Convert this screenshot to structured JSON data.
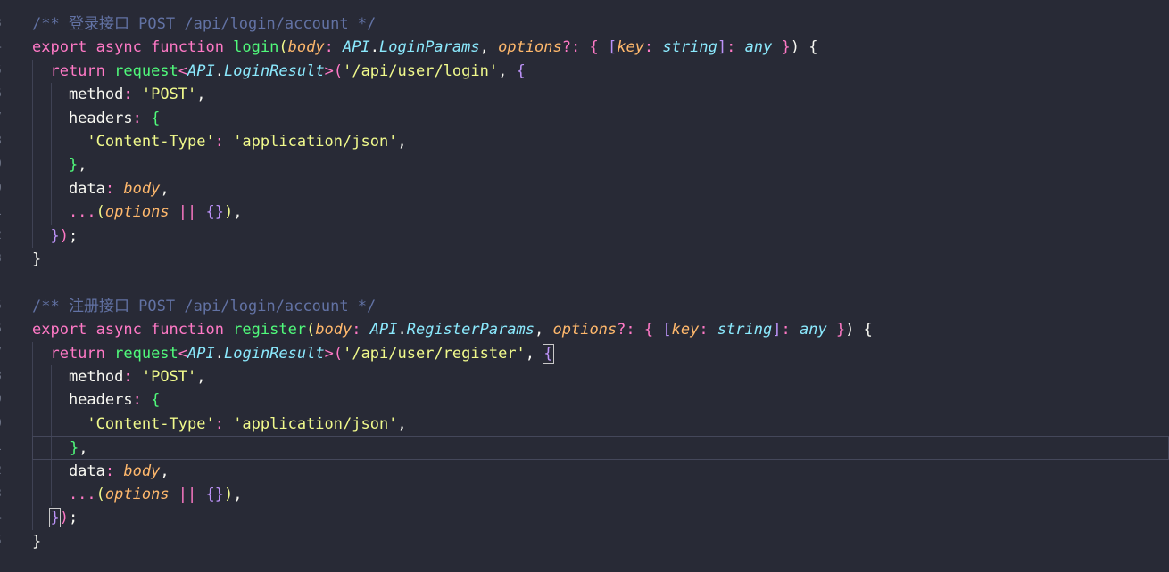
{
  "editor": {
    "gutter_numbers": [
      "3",
      "4",
      "5",
      "6",
      "7",
      "8",
      "9",
      "0",
      "1",
      "2",
      "3",
      "",
      "5",
      "6",
      "7",
      "8",
      "9",
      "0",
      "1",
      "2",
      "3",
      "4",
      "5"
    ],
    "lines": [
      [
        {
          "t": "/** 登录接口 POST /api/login/account */",
          "c": "c-comment"
        }
      ],
      [
        {
          "t": "export async function ",
          "c": "c-kw"
        },
        {
          "t": "login",
          "c": "c-fn"
        },
        {
          "t": "(",
          "c": "c-b1"
        },
        {
          "t": "body",
          "c": "c-param"
        },
        {
          "t": ": ",
          "c": "c-op"
        },
        {
          "t": "API",
          "c": "c-type"
        },
        {
          "t": ".",
          "c": "c-punc"
        },
        {
          "t": "LoginParams",
          "c": "c-type"
        },
        {
          "t": ", ",
          "c": "c-punc"
        },
        {
          "t": "options",
          "c": "c-param"
        },
        {
          "t": "?: ",
          "c": "c-op"
        },
        {
          "t": "{ ",
          "c": "c-b2"
        },
        {
          "t": "[",
          "c": "c-b3"
        },
        {
          "t": "key",
          "c": "c-param"
        },
        {
          "t": ": ",
          "c": "c-op"
        },
        {
          "t": "string",
          "c": "c-type"
        },
        {
          "t": "]",
          "c": "c-b3"
        },
        {
          "t": ": ",
          "c": "c-op"
        },
        {
          "t": "any",
          "c": "c-type"
        },
        {
          "t": " }",
          "c": "c-b2"
        },
        {
          "t": ") {",
          "c": "c-punc"
        }
      ],
      [
        {
          "t": "  return ",
          "c": "c-kw"
        },
        {
          "t": "request",
          "c": "c-fn"
        },
        {
          "t": "<",
          "c": "c-op"
        },
        {
          "t": "API",
          "c": "c-type"
        },
        {
          "t": ".",
          "c": "c-punc"
        },
        {
          "t": "LoginResult",
          "c": "c-type"
        },
        {
          "t": ">",
          "c": "c-op"
        },
        {
          "t": "(",
          "c": "c-b2"
        },
        {
          "t": "'/api/user/login'",
          "c": "c-str"
        },
        {
          "t": ", ",
          "c": "c-punc"
        },
        {
          "t": "{",
          "c": "c-b3"
        }
      ],
      [
        {
          "t": "    method",
          "c": "c-prop"
        },
        {
          "t": ": ",
          "c": "c-op"
        },
        {
          "t": "'POST'",
          "c": "c-str"
        },
        {
          "t": ",",
          "c": "c-punc"
        }
      ],
      [
        {
          "t": "    headers",
          "c": "c-prop"
        },
        {
          "t": ": ",
          "c": "c-op"
        },
        {
          "t": "{",
          "c": "c-b1g"
        }
      ],
      [
        {
          "t": "      'Content-Type'",
          "c": "c-str"
        },
        {
          "t": ": ",
          "c": "c-op"
        },
        {
          "t": "'application/json'",
          "c": "c-str"
        },
        {
          "t": ",",
          "c": "c-punc"
        }
      ],
      [
        {
          "t": "    }",
          "c": "c-b1g"
        },
        {
          "t": ",",
          "c": "c-punc"
        }
      ],
      [
        {
          "t": "    data",
          "c": "c-prop"
        },
        {
          "t": ": ",
          "c": "c-op"
        },
        {
          "t": "body",
          "c": "c-param"
        },
        {
          "t": ",",
          "c": "c-punc"
        }
      ],
      [
        {
          "t": "    ...",
          "c": "c-op"
        },
        {
          "t": "(",
          "c": "c-b1"
        },
        {
          "t": "options",
          "c": "c-param"
        },
        {
          "t": " || ",
          "c": "c-op"
        },
        {
          "t": "{}",
          "c": "c-b3"
        },
        {
          "t": ")",
          "c": "c-b1"
        },
        {
          "t": ",",
          "c": "c-punc"
        }
      ],
      [
        {
          "t": "  }",
          "c": "c-b3"
        },
        {
          "t": ")",
          "c": "c-b2"
        },
        {
          "t": ";",
          "c": "c-punc"
        }
      ],
      [
        {
          "t": "}",
          "c": "c-punc"
        }
      ],
      [
        {
          "t": "",
          "c": "c-punc"
        }
      ],
      [
        {
          "t": "/** 注册接口 POST /api/login/account */",
          "c": "c-comment"
        }
      ],
      [
        {
          "t": "export async function ",
          "c": "c-kw"
        },
        {
          "t": "register",
          "c": "c-fn"
        },
        {
          "t": "(",
          "c": "c-b1"
        },
        {
          "t": "body",
          "c": "c-param"
        },
        {
          "t": ": ",
          "c": "c-op"
        },
        {
          "t": "API",
          "c": "c-type"
        },
        {
          "t": ".",
          "c": "c-punc"
        },
        {
          "t": "RegisterParams",
          "c": "c-type"
        },
        {
          "t": ", ",
          "c": "c-punc"
        },
        {
          "t": "options",
          "c": "c-param"
        },
        {
          "t": "?: ",
          "c": "c-op"
        },
        {
          "t": "{ ",
          "c": "c-b2"
        },
        {
          "t": "[",
          "c": "c-b3"
        },
        {
          "t": "key",
          "c": "c-param"
        },
        {
          "t": ": ",
          "c": "c-op"
        },
        {
          "t": "string",
          "c": "c-type"
        },
        {
          "t": "]",
          "c": "c-b3"
        },
        {
          "t": ": ",
          "c": "c-op"
        },
        {
          "t": "any",
          "c": "c-type"
        },
        {
          "t": " }",
          "c": "c-b2"
        },
        {
          "t": ") {",
          "c": "c-punc"
        }
      ],
      [
        {
          "t": "  return ",
          "c": "c-kw"
        },
        {
          "t": "request",
          "c": "c-fn"
        },
        {
          "t": "<",
          "c": "c-op"
        },
        {
          "t": "API",
          "c": "c-type"
        },
        {
          "t": ".",
          "c": "c-punc"
        },
        {
          "t": "LoginResult",
          "c": "c-type"
        },
        {
          "t": ">",
          "c": "c-op"
        },
        {
          "t": "(",
          "c": "c-b2"
        },
        {
          "t": "'/api/user/register'",
          "c": "c-str"
        },
        {
          "t": ", ",
          "c": "c-punc"
        },
        {
          "t": "{",
          "c": "c-b3 bracket-match"
        }
      ],
      [
        {
          "t": "    method",
          "c": "c-prop"
        },
        {
          "t": ": ",
          "c": "c-op"
        },
        {
          "t": "'POST'",
          "c": "c-str"
        },
        {
          "t": ",",
          "c": "c-punc"
        }
      ],
      [
        {
          "t": "    headers",
          "c": "c-prop"
        },
        {
          "t": ": ",
          "c": "c-op"
        },
        {
          "t": "{",
          "c": "c-b1g"
        }
      ],
      [
        {
          "t": "      'Content-Type'",
          "c": "c-str"
        },
        {
          "t": ": ",
          "c": "c-op"
        },
        {
          "t": "'application/json'",
          "c": "c-str"
        },
        {
          "t": ",",
          "c": "c-punc"
        }
      ],
      [
        {
          "t": "    }",
          "c": "c-b1g"
        },
        {
          "t": ",",
          "c": "c-punc"
        }
      ],
      [
        {
          "t": "    data",
          "c": "c-prop"
        },
        {
          "t": ": ",
          "c": "c-op"
        },
        {
          "t": "body",
          "c": "c-param"
        },
        {
          "t": ",",
          "c": "c-punc"
        }
      ],
      [
        {
          "t": "    ...",
          "c": "c-op"
        },
        {
          "t": "(",
          "c": "c-b1"
        },
        {
          "t": "options",
          "c": "c-param"
        },
        {
          "t": " || ",
          "c": "c-op"
        },
        {
          "t": "{}",
          "c": "c-b3"
        },
        {
          "t": ")",
          "c": "c-b1"
        },
        {
          "t": ",",
          "c": "c-punc"
        }
      ],
      [
        {
          "t": "  ",
          "c": "c-punc"
        },
        {
          "t": "}",
          "c": "c-b3 bracket-match"
        },
        {
          "t": ")",
          "c": "c-b2"
        },
        {
          "t": ";",
          "c": "c-punc"
        }
      ],
      [
        {
          "t": "}",
          "c": "c-punc"
        }
      ]
    ],
    "current_line": 18
  },
  "colors": {
    "background": "#282a36",
    "comment": "#6272a4",
    "keyword": "#ff79c6",
    "function": "#50fa7b",
    "string": "#f1fa8c",
    "type": "#8be9fd",
    "parameter": "#ffb86c"
  }
}
